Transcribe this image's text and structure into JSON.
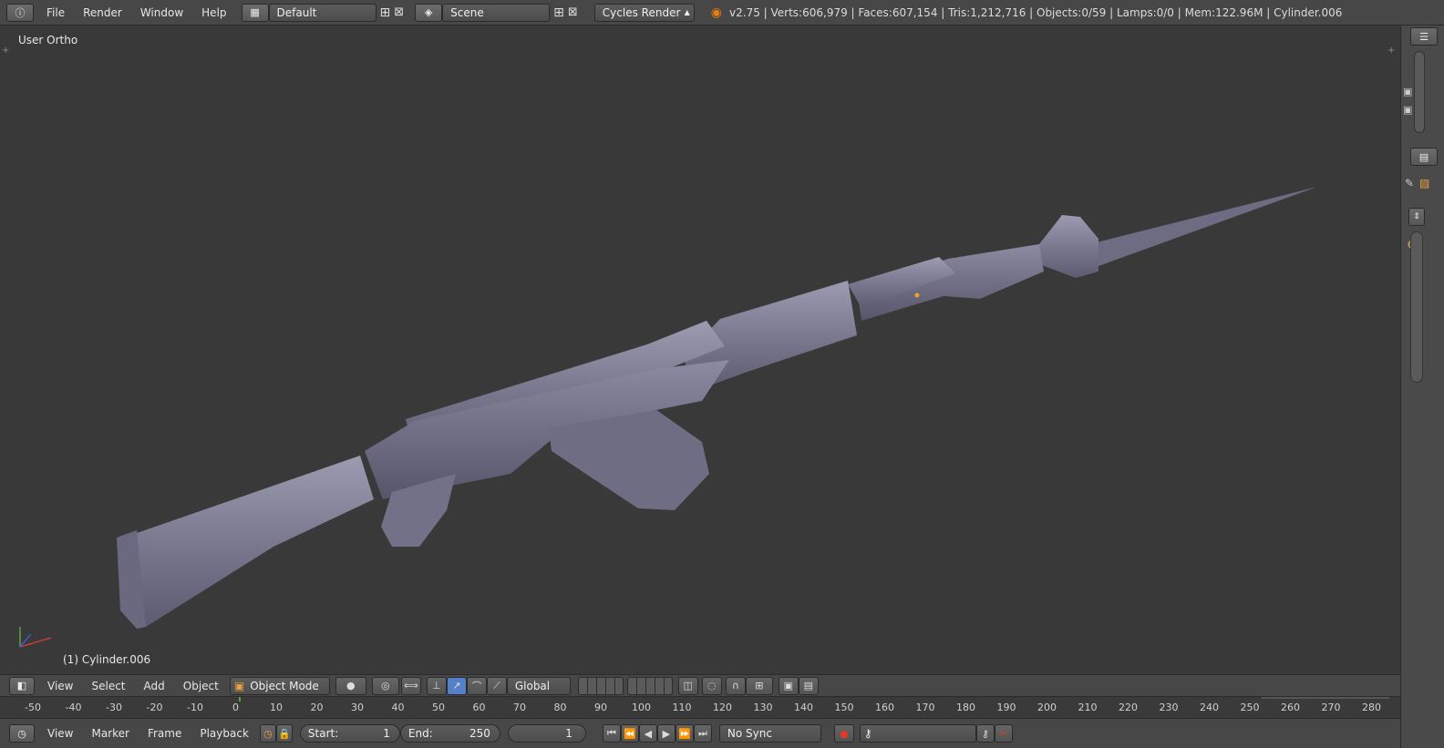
{
  "topbar": {
    "menus": [
      "File",
      "Render",
      "Window",
      "Help"
    ],
    "layout": "Default",
    "scene": "Scene",
    "engine": "Cycles Render",
    "stats": "v2.75 | Verts:606,979 | Faces:607,154 | Tris:1,212,716 | Objects:0/59 | Lamps:0/0 | Mem:122.96M | Cylinder.006"
  },
  "viewport": {
    "view_label": "User Ortho",
    "object_label": "(1) Cylinder.006",
    "axis_x_color": "#c33b3b",
    "axis_y_color": "#5fa23a",
    "axis_z_color": "#3b5fd0"
  },
  "viewheader": {
    "menus": [
      "View",
      "Select",
      "Add",
      "Object"
    ],
    "mode": "Object Mode",
    "orientation": "Global"
  },
  "ruler": {
    "ticks": [
      "-50",
      "-40",
      "-30",
      "-20",
      "-10",
      "0",
      "10",
      "20",
      "30",
      "40",
      "50",
      "60",
      "70",
      "80",
      "90",
      "100",
      "110",
      "120",
      "130",
      "140",
      "150",
      "160",
      "170",
      "180",
      "190",
      "200",
      "210",
      "220",
      "230",
      "240",
      "250",
      "260",
      "270",
      "280"
    ]
  },
  "timeheader": {
    "menus": [
      "View",
      "Marker",
      "Frame",
      "Playback"
    ],
    "start_label": "Start:",
    "start_value": "1",
    "end_label": "End:",
    "end_value": "250",
    "current_frame": "1",
    "sync": "No Sync"
  }
}
